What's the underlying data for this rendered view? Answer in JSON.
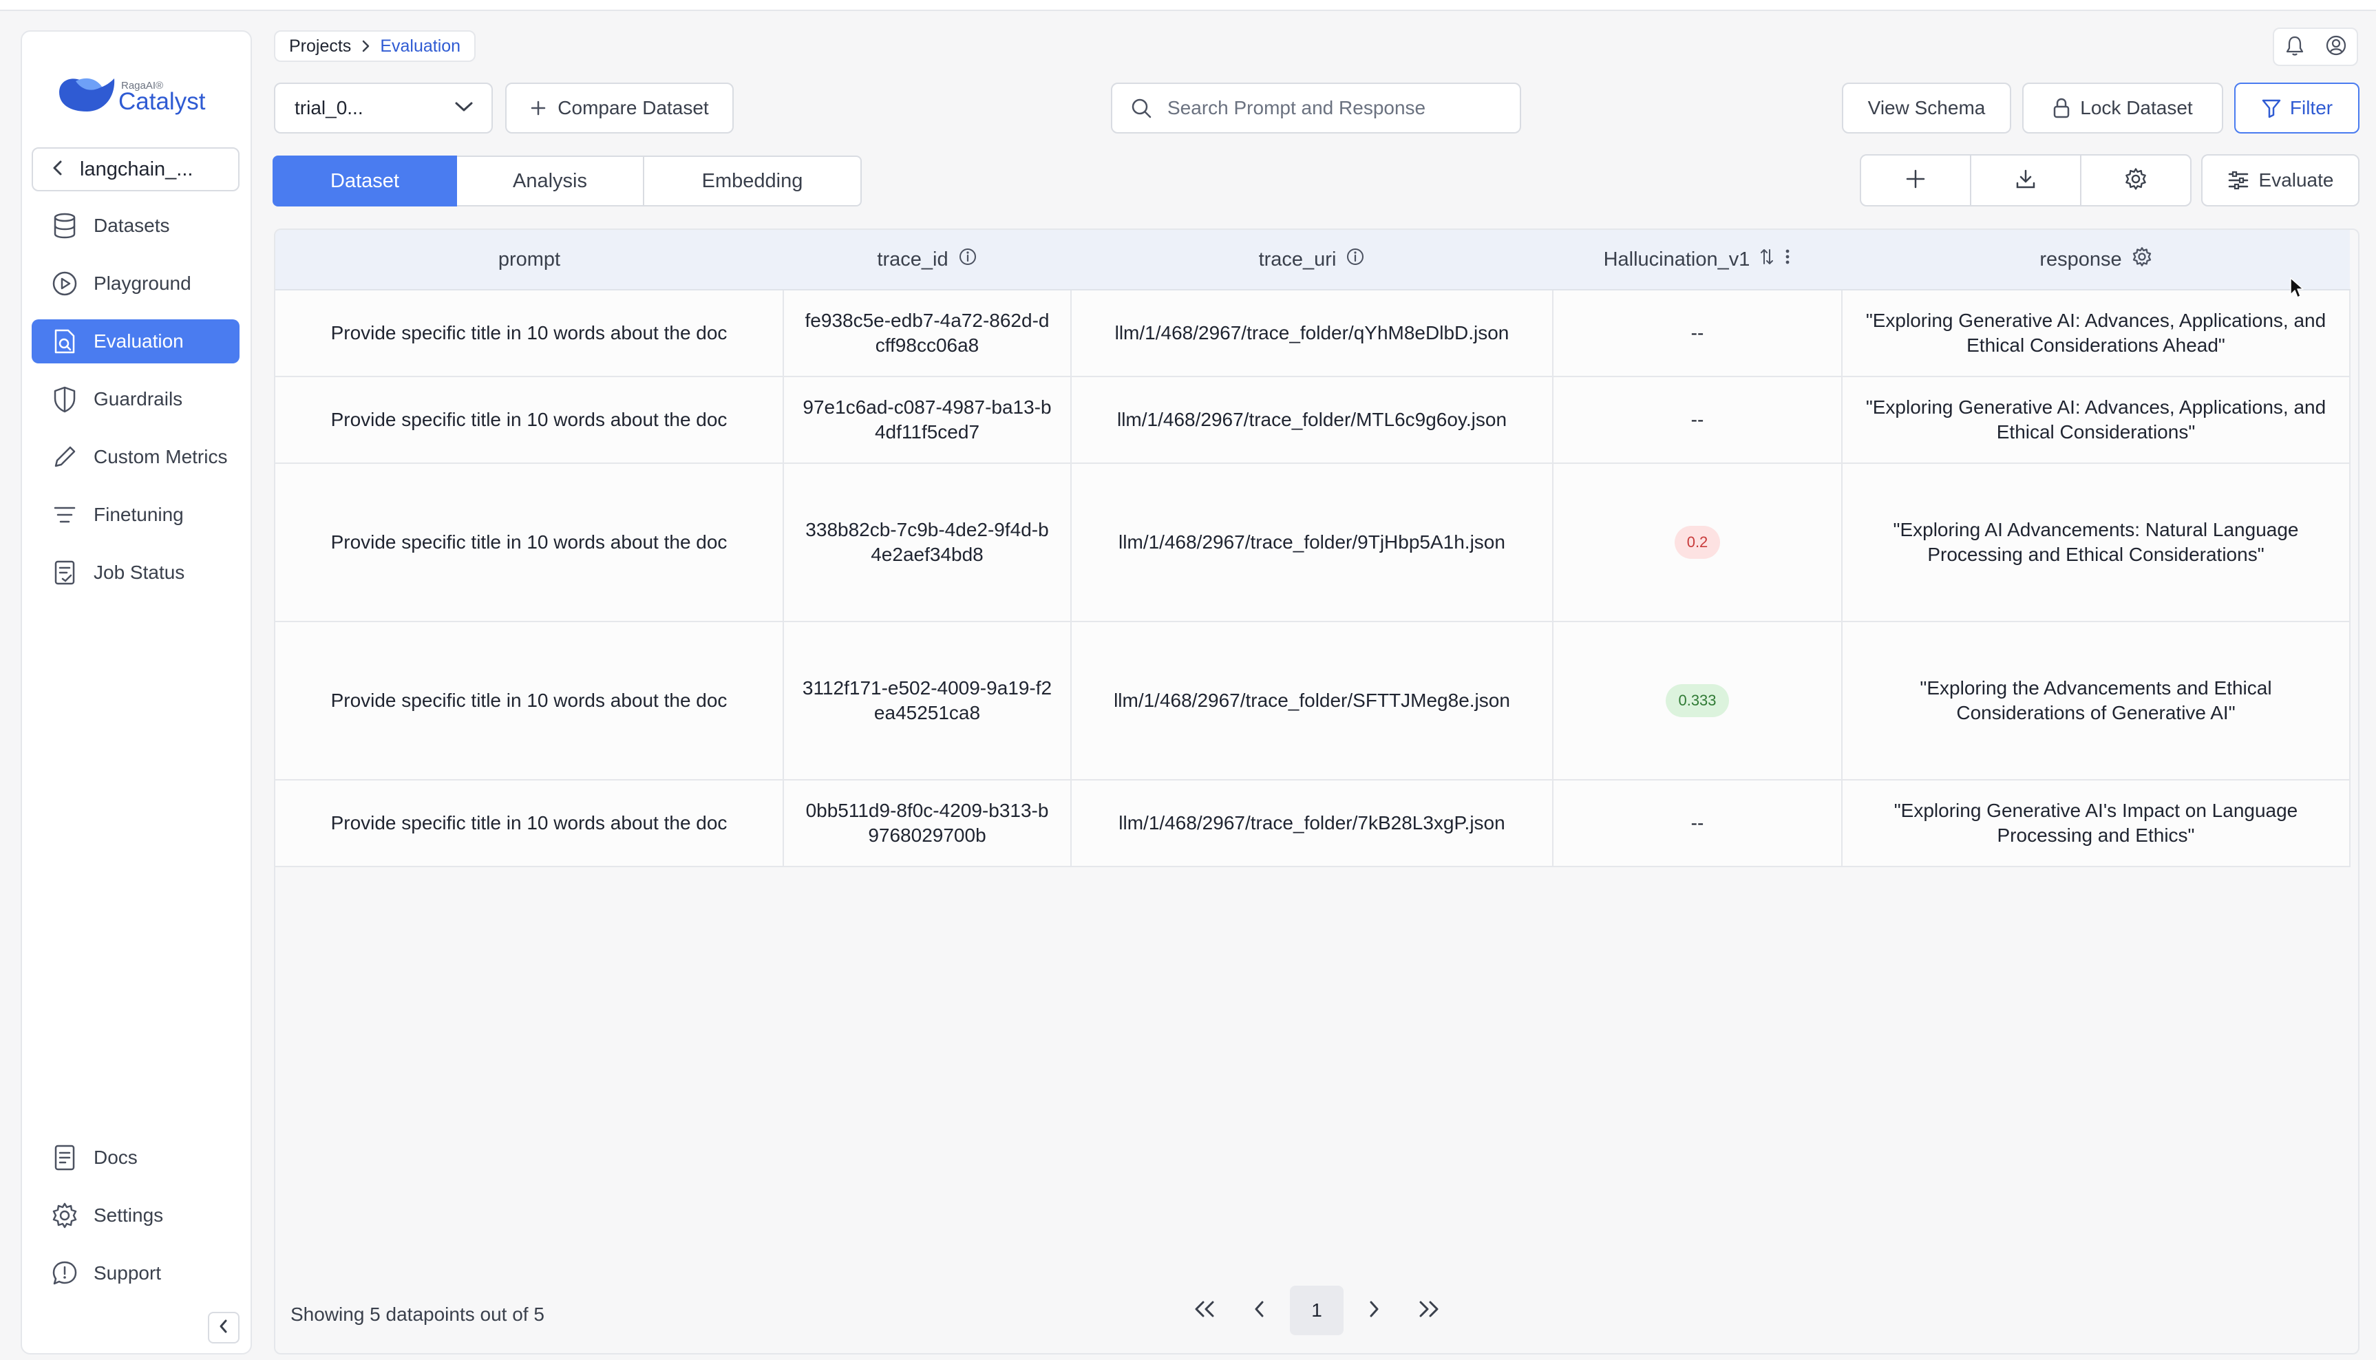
{
  "app": {
    "brand_small": "RagaAI®",
    "brand_name": "Catalyst"
  },
  "sidebar": {
    "project": "langchain_...",
    "items": [
      {
        "label": "Datasets",
        "icon": "database-icon"
      },
      {
        "label": "Playground",
        "icon": "play-circle-icon"
      },
      {
        "label": "Evaluation",
        "icon": "evaluation-icon",
        "active": true
      },
      {
        "label": "Guardrails",
        "icon": "shield-icon"
      },
      {
        "label": "Custom Metrics",
        "icon": "pencil-icon"
      },
      {
        "label": "Finetuning",
        "icon": "list-icon"
      },
      {
        "label": "Job Status",
        "icon": "clipboard-check-icon"
      }
    ],
    "bottom_items": [
      {
        "label": "Docs",
        "icon": "document-icon"
      },
      {
        "label": "Settings",
        "icon": "gear-icon"
      },
      {
        "label": "Support",
        "icon": "support-icon"
      }
    ]
  },
  "breadcrumb": {
    "parent": "Projects",
    "current": "Evaluation"
  },
  "toolbar": {
    "dataset_selected": "trial_0...",
    "compare_label": "Compare Dataset",
    "search_placeholder": "Search Prompt and Response",
    "view_schema_label": "View Schema",
    "lock_label": "Lock Dataset",
    "filter_label": "Filter",
    "evaluate_label": "Evaluate"
  },
  "tabs": [
    "Dataset",
    "Analysis",
    "Embedding"
  ],
  "table": {
    "columns": [
      "prompt",
      "trace_id",
      "trace_uri",
      "Hallucination_v1",
      "response"
    ],
    "rows": [
      {
        "prompt": "Provide specific title in 10 words about the doc",
        "trace_id": "fe938c5e-edb7-4a72-862d-dcff98cc06a8",
        "trace_uri": "llm/1/468/2967/trace_folder/qYhM8eDlbD.json",
        "hallucination": "--",
        "response": "\"Exploring Generative AI: Advances, Applications, and Ethical Considerations Ahead\""
      },
      {
        "prompt": "Provide specific title in 10 words about the doc",
        "trace_id": "97e1c6ad-c087-4987-ba13-b4df11f5ced7",
        "trace_uri": "llm/1/468/2967/trace_folder/MTL6c9g6oy.json",
        "hallucination": "--",
        "response": "\"Exploring Generative AI: Advances, Applications, and Ethical Considerations\""
      },
      {
        "prompt": "Provide specific title in 10 words about the doc",
        "trace_id": "338b82cb-7c9b-4de2-9f4d-b4e2aef34bd8",
        "trace_uri": "llm/1/468/2967/trace_folder/9TjHbp5A1h.json",
        "hallucination": "0.2",
        "response": "\"Exploring AI Advancements: Natural Language Processing and Ethical Considerations\""
      },
      {
        "prompt": "Provide specific title in 10 words about the doc",
        "trace_id": "3112f171-e502-4009-9a19-f2ea45251ca8",
        "trace_uri": "llm/1/468/2967/trace_folder/SFTTJMeg8e.json",
        "hallucination": "0.333",
        "response": "\"Exploring the Advancements and Ethical Considerations of Generative AI\""
      },
      {
        "prompt": "Provide specific title in 10 words about the doc",
        "trace_id": "0bb511d9-8f0c-4209-b313-b9768029700b",
        "trace_uri": "llm/1/468/2967/trace_folder/7kB28L3xgP.json",
        "hallucination": "--",
        "response": "\"Exploring Generative AI's Impact on Language Processing and Ethics\""
      }
    ]
  },
  "footer": {
    "showing": "Showing 5 datapoints out of 5",
    "current_page": "1"
  },
  "colors": {
    "accent": "#4a7cf0",
    "badge_red_bg": "#fde2e2",
    "badge_green_bg": "#dcf3dd"
  }
}
